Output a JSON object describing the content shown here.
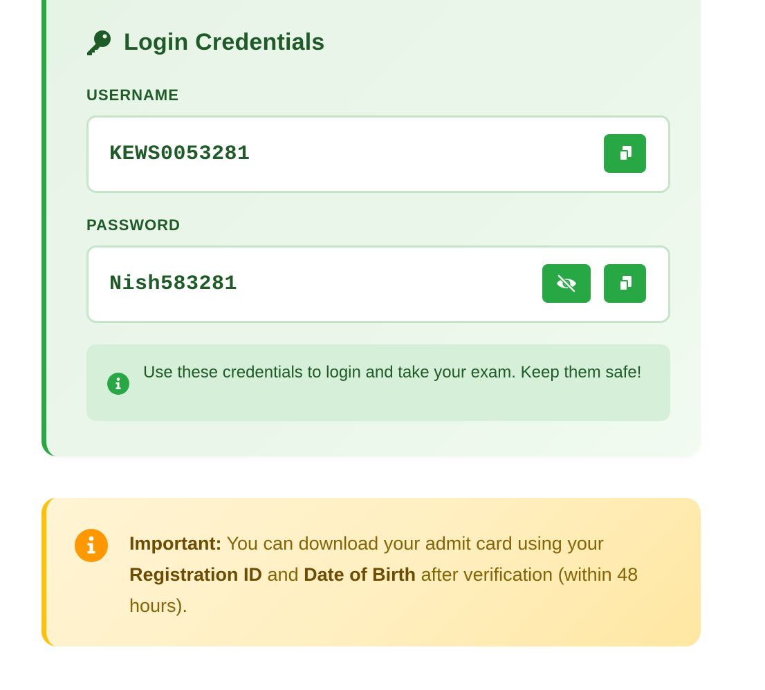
{
  "credentials": {
    "title": "Login Credentials",
    "title_icon": "key-icon",
    "username": {
      "label": "USERNAME",
      "value": "KEWS0053281",
      "copy_icon": "copy-icon"
    },
    "password": {
      "label": "PASSWORD",
      "value": "Nish583281",
      "toggle_icon": "eye-slash-icon",
      "copy_icon": "copy-icon"
    },
    "note": {
      "icon": "info-circle-icon",
      "text": "Use these credentials to login and take your exam. Keep them safe!"
    }
  },
  "notice": {
    "icon": "info-circle-icon",
    "lead": "Important:",
    "text_1": " You can download your admit card using your ",
    "reg_id": "Registration ID",
    "text_2": " and ",
    "dob": "Date of Birth",
    "text_3": " after verification (within 48 hours)."
  },
  "colors": {
    "accent_green": "#28a745",
    "text_green": "#1e5b27",
    "accent_amber": "#ffc107",
    "notice_text": "#856404",
    "info_orange": "#ff9800"
  }
}
